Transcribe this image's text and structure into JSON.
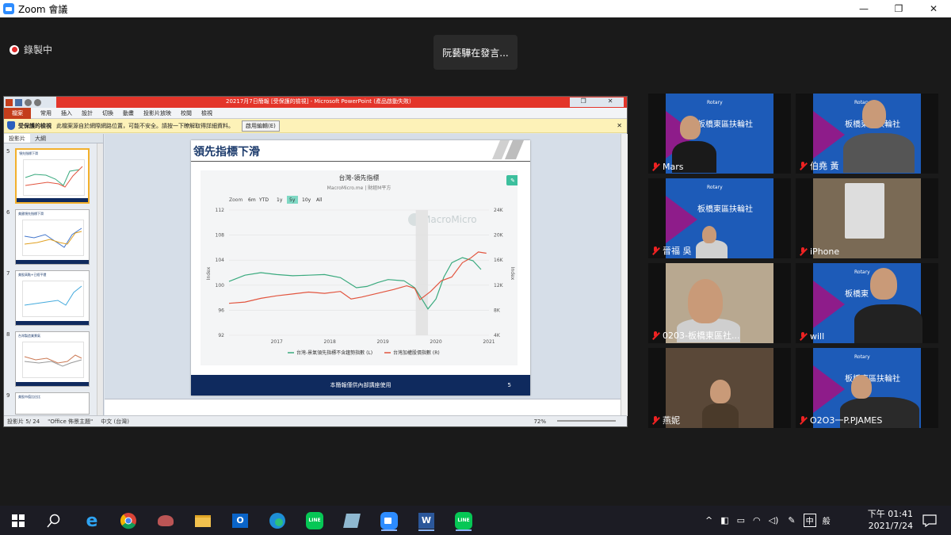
{
  "window": {
    "title": "Zoom 會議"
  },
  "recording": {
    "label": "錄製中"
  },
  "speaker_banner": {
    "text": "阮藝驊在發言..."
  },
  "ppt": {
    "doc_title": "20217月7日簡報 [受保護的檢視] - Microsoft PowerPoint (產品啟動失敗)",
    "ribbon_tabs": [
      "檔案",
      "常用",
      "插入",
      "設計",
      "切換",
      "動畫",
      "投影片放映",
      "校閱",
      "檢視"
    ],
    "security_bar": {
      "title": "受保護的檢視",
      "message": "此檔案源自於網際網路位置，可能不安全。請按一下瞭解取得詳細資料。",
      "button": "啟用編輯(E)"
    },
    "panel_tabs": [
      "投影片",
      "大綱"
    ],
    "slide_numbers": [
      "5",
      "6",
      "7",
      "8",
      "9"
    ],
    "thumb_titles": [
      "領先指標下滑",
      "美國領先指標下滑",
      "美股高點+已經平穩",
      "台灣製造業景氣",
      "美股市值比佔比"
    ],
    "slide": {
      "title": "領先指標下滑",
      "footer": "本簡報僅供內部講座使用",
      "page": "5"
    },
    "status": {
      "slide_info": "投影片 5/ 24",
      "theme": "\"Office 佈景主題\"",
      "lang": "中文 (台灣)",
      "zoom": "72%"
    }
  },
  "chart_data": {
    "type": "line",
    "title": "台灣-領先指標",
    "subtitle": "MacroMicro.me | 財經M平方",
    "watermark": "MacroMicro",
    "zoom_label": "Zoom",
    "zoom_options": [
      "6m",
      "YTD",
      "1y",
      "5y",
      "10y",
      "All"
    ],
    "zoom_selected": "5y",
    "xlabel_ticks": [
      "2017",
      "2018",
      "2019",
      "2020",
      "2021"
    ],
    "y_left": {
      "label": "Index",
      "ticks": [
        "112",
        "108",
        "104",
        "100",
        "96",
        "92"
      ],
      "ylim": [
        92,
        112
      ]
    },
    "y_right": {
      "label": "Index",
      "ticks": [
        "24K",
        "20K",
        "16K",
        "12K",
        "8K",
        "4K"
      ],
      "ylim": [
        4000,
        24000
      ]
    },
    "series": [
      {
        "name": "台灣-景氣領先指標不含趨勢指數 (L)",
        "color": "#3aaa7e",
        "axis": "left",
        "x": [
          2016.6,
          2016.9,
          2017.2,
          2017.5,
          2017.8,
          2018.1,
          2018.4,
          2018.7,
          2019.0,
          2019.2,
          2019.4,
          2019.6,
          2019.9,
          2020.1,
          2020.25,
          2020.35,
          2020.5,
          2020.65,
          2020.8,
          2021.0,
          2021.2,
          2021.35
        ],
        "values": [
          100.6,
          101.6,
          102.0,
          101.7,
          101.5,
          101.6,
          101.7,
          101.2,
          99.6,
          99.8,
          100.4,
          100.9,
          100.7,
          99.6,
          97.6,
          96.2,
          97.8,
          101.3,
          103.6,
          104.4,
          103.9,
          102.5
        ]
      },
      {
        "name": "台灣加權股價指數 (R)",
        "color": "#e2553f",
        "axis": "right",
        "x": [
          2016.6,
          2016.9,
          2017.2,
          2017.5,
          2017.8,
          2018.1,
          2018.4,
          2018.7,
          2018.9,
          2019.1,
          2019.4,
          2019.7,
          2019.95,
          2020.1,
          2020.2,
          2020.4,
          2020.6,
          2020.8,
          2021.0,
          2021.15,
          2021.3,
          2021.45
        ],
        "values": [
          9100,
          9300,
          9900,
          10300,
          10600,
          10900,
          10700,
          11000,
          9800,
          10100,
          10700,
          11300,
          11900,
          11500,
          9700,
          11000,
          12700,
          13300,
          15600,
          16300,
          17300,
          17100
        ]
      }
    ]
  },
  "participants": [
    {
      "name": "Mars",
      "club": "板橋東區扶輪社",
      "rotary": "Rotary"
    },
    {
      "name": "伯堯 黃",
      "club": "板橋東區扶輪社",
      "rotary": "Rotary"
    },
    {
      "name": "晉福 吳",
      "club": "板橋東區扶輪社",
      "rotary": "Rotary"
    },
    {
      "name": "iPhone",
      "club": "",
      "rotary": ""
    },
    {
      "name": "0203-板橋東區社...",
      "club": "",
      "rotary": ""
    },
    {
      "name": "will",
      "club": "板橋東",
      "rotary": "Rotary"
    },
    {
      "name": "燕妮",
      "club": "",
      "rotary": ""
    },
    {
      "name": "O2O3一P.PJAMES",
      "club": "板橋東區扶輪社",
      "rotary": "Rotary"
    }
  ],
  "taskbar": {
    "icons": [
      "windows-start",
      "search",
      "internet-explorer",
      "chrome",
      "app",
      "file-explorer",
      "outlook",
      "edge",
      "line",
      "notes-app",
      "zoom",
      "word",
      "line-2"
    ],
    "ime": "中",
    "ime2": "般",
    "time": "下午 01:41",
    "date": "2021/7/24"
  }
}
